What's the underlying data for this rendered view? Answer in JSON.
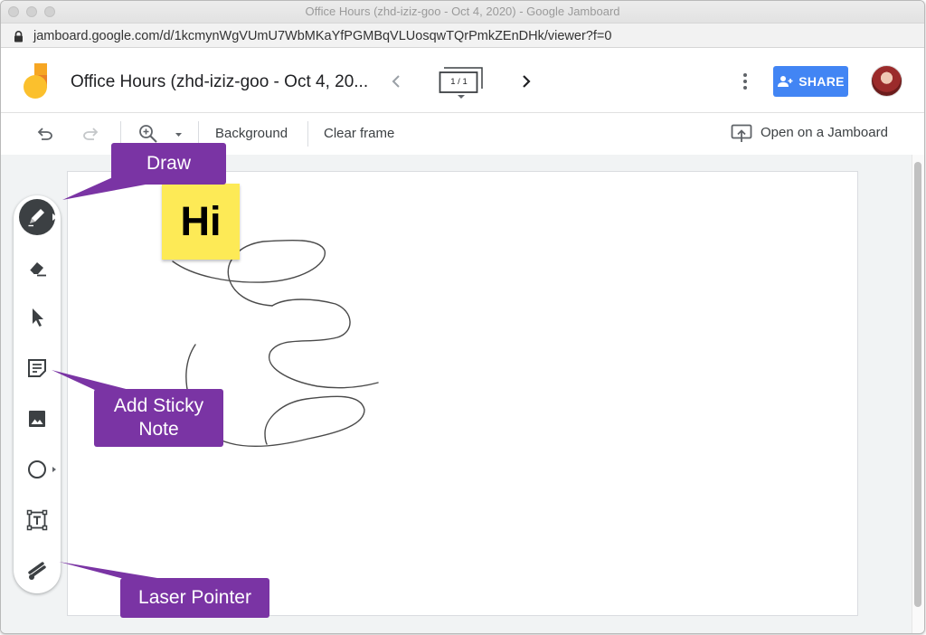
{
  "window": {
    "title": "Office Hours (zhd-iziz-goo - Oct 4, 2020) - Google Jamboard"
  },
  "browser": {
    "url": "jamboard.google.com/d/1kcmynWgVUmU7WbMKaYfPGMBqVLUosqwTQrPmkZEnDHk/viewer?f=0"
  },
  "header": {
    "title": "Office Hours (zhd-iziz-goo - Oct 4, 20...",
    "frame_counter": "1 / 1",
    "share_label": "SHARE"
  },
  "toolbar": {
    "background_label": "Background",
    "clear_frame_label": "Clear frame",
    "open_on_jamboard_label": "Open on a Jamboard"
  },
  "canvas": {
    "sticky_note_text": "Hi",
    "sticky_color": "#fdea56"
  },
  "tools": [
    {
      "name": "pen",
      "icon": "pen-icon"
    },
    {
      "name": "eraser",
      "icon": "eraser-icon"
    },
    {
      "name": "select",
      "icon": "cursor-icon"
    },
    {
      "name": "sticky-note",
      "icon": "sticky-note-icon"
    },
    {
      "name": "image",
      "icon": "image-icon"
    },
    {
      "name": "circle",
      "icon": "circle-icon"
    },
    {
      "name": "text-box",
      "icon": "text-box-icon"
    },
    {
      "name": "laser",
      "icon": "laser-icon"
    }
  ],
  "callouts": {
    "draw": "Draw",
    "sticky_line1": "Add Sticky",
    "sticky_line2": "Note",
    "laser": "Laser Pointer"
  },
  "colors": {
    "accent": "#4285f4",
    "callout": "#7a34a4",
    "active_tool": "#3c4043"
  }
}
